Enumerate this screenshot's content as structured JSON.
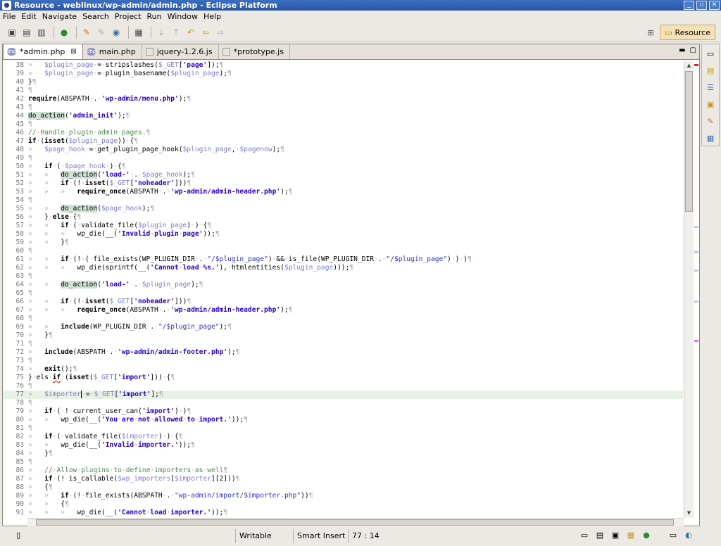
{
  "window": {
    "title": "Resource - weblinux/wp-admin/admin.php - Eclipse Platform",
    "controls": [
      "_",
      "▫",
      "✕"
    ]
  },
  "menu": [
    "File",
    "Edit",
    "Navigate",
    "Search",
    "Project",
    "Run",
    "Window",
    "Help"
  ],
  "perspective": {
    "label": "Resource"
  },
  "tabs": [
    {
      "label": "*admin.php",
      "icon": "php-file-icon",
      "active": true,
      "close": "⊠"
    },
    {
      "label": "main.php",
      "icon": "php-file-icon",
      "active": false
    },
    {
      "label": "jquery-1.2.6.js",
      "icon": "js-file-icon",
      "active": false
    },
    {
      "label": "*prototype.js",
      "icon": "js-file-icon",
      "active": false
    }
  ],
  "status": {
    "mode": "Writable",
    "insert": "Smart Insert",
    "position": "77 : 14"
  },
  "code": {
    "current_line": 77,
    "lines": [
      {
        "n": "38",
        "h": "<span class='ws'>»   </span><span class='var'>$plugin_page</span><span class='ws'>·</span>=<span class='ws'>·</span>stripslashes(<span class='var'>$_GET</span>[<span class='str'>'page'</span>]);<span class='ws'>¶</span>"
      },
      {
        "n": "39",
        "h": "<span class='ws'>»   </span><span class='var'>$plugin_page</span><span class='ws'>·</span>=<span class='ws'>·</span>plugin_basename(<span class='var'>$plugin_page</span>);<span class='ws'>¶</span>"
      },
      {
        "n": "40",
        "h": "}<span class='ws'>¶</span>"
      },
      {
        "n": "41",
        "h": "<span class='ws'>¶</span>"
      },
      {
        "n": "42",
        "h": "<span class='kw'>require</span>(ABSPATH<span class='ws'>·</span>.<span class='ws'>·</span><span class='str'>'wp-admin/menu.php'</span>);<span class='ws'>¶</span>"
      },
      {
        "n": "43",
        "h": "<span class='ws'>¶</span>"
      },
      {
        "n": "44",
        "h": "<span class='hl'>do_action</span>(<span class='str'>'admin_init'</span>);<span class='ws'>¶</span>"
      },
      {
        "n": "45",
        "h": "<span class='ws'>¶</span>"
      },
      {
        "n": "46",
        "h": "<span class='cmt'>//<span class='ws'>·</span>Handle<span class='ws'>·</span>plugin<span class='ws'>·</span>admin<span class='ws'>·</span>pages.</span><span class='ws'>¶</span>"
      },
      {
        "n": "47",
        "h": "<span class='kw'>if</span><span class='ws'>·</span>(<span class='kw'>isset</span>(<span class='var'>$plugin_page</span>))<span class='ws'>·</span>{<span class='ws'>¶</span>"
      },
      {
        "n": "48",
        "h": "<span class='ws'>»   </span><span class='var'>$page_hook</span><span class='ws'>·</span>=<span class='ws'>·</span>get_plugin_page_hook(<span class='var'>$plugin_page</span>,<span class='ws'>·</span><span class='var'>$pagenow</span>);<span class='ws'>¶</span>"
      },
      {
        "n": "49",
        "h": "<span class='ws'>¶</span>"
      },
      {
        "n": "50",
        "h": "<span class='ws'>»   </span><span class='kw'>if</span><span class='ws'>·</span>(<span class='ws'>·</span><span class='var'>$page_hook</span><span class='ws'>·</span>)<span class='ws'>·</span>{<span class='ws'>¶</span>"
      },
      {
        "n": "51",
        "h": "<span class='ws'>»   »   </span><span class='hl'>do_action</span>(<span class='str'>'load-'</span><span class='ws'>·</span>.<span class='ws'>·</span><span class='var'>$page_hook</span>);<span class='ws'>¶</span>"
      },
      {
        "n": "52",
        "h": "<span class='ws'>»   »   </span><span class='kw'>if</span><span class='ws'>·</span>(!<span class='ws'>·</span><span class='kw'>isset</span>(<span class='var'>$_GET</span>[<span class='str'>'noheader'</span>]))<span class='ws'>¶</span>"
      },
      {
        "n": "53",
        "h": "<span class='ws'>»   »   »   </span><span class='kw'>require_once</span>(ABSPATH<span class='ws'>·</span>.<span class='ws'>·</span><span class='str'>'wp-admin/admin-header.php'</span>);<span class='ws'>¶</span>"
      },
      {
        "n": "54",
        "h": "<span class='ws'>¶</span>"
      },
      {
        "n": "55",
        "h": "<span class='ws'>»   »   </span><span class='hl'>do_action</span>(<span class='var'>$page_hook</span>);<span class='ws'>¶</span>"
      },
      {
        "n": "56",
        "h": "<span class='ws'>»   </span>}<span class='ws'>·</span><span class='kw'>else</span><span class='ws'>·</span>{<span class='ws'>¶</span>"
      },
      {
        "n": "57",
        "h": "<span class='ws'>»   »   </span><span class='kw'>if</span><span class='ws'>·</span>(<span class='ws'>·</span>validate_file(<span class='var'>$plugin_page</span>)<span class='ws'>·</span>)<span class='ws'>·</span>{<span class='ws'>¶</span>"
      },
      {
        "n": "58",
        "h": "<span class='ws'>»   »   »   </span>wp_die(__(<span class='str'>'Invalid<span class='ws'>·</span>plugin<span class='ws'>·</span>page'</span>));<span class='ws'>¶</span>"
      },
      {
        "n": "59",
        "h": "<span class='ws'>»   »   </span>}<span class='ws'>¶</span>"
      },
      {
        "n": "60",
        "h": "<span class='ws'>¶</span>"
      },
      {
        "n": "61",
        "h": "<span class='ws'>»   »   </span><span class='kw'>if</span><span class='ws'>·</span>(!<span class='ws'>·</span>(<span class='ws'>·</span>file_exists(WP_PLUGIN_DIR<span class='ws'>·</span>.<span class='ws'>·</span><span class='str2'>\"/$plugin_page\"</span>)<span class='ws'>·</span>&amp;&amp;<span class='ws'>·</span>is_file(WP_PLUGIN_DIR<span class='ws'>·</span>.<span class='ws'>·</span><span class='str2'>\"/$plugin_page\"</span>)<span class='ws'>·</span>)<span class='ws'>·</span>)<span class='ws'>¶</span>"
      },
      {
        "n": "62",
        "h": "<span class='ws'>»   »   »   </span>wp_die(sprintf(__(<span class='str'>'Cannot<span class='ws'>·</span>load<span class='ws'>·</span>%s.'</span>),<span class='ws'>·</span>htmlentities(<span class='var'>$plugin_page</span>)));<span class='ws'>¶</span>"
      },
      {
        "n": "63",
        "h": "<span class='ws'>¶</span>"
      },
      {
        "n": "64",
        "h": "<span class='ws'>»   »   </span><span class='hl'>do_action</span>(<span class='str'>'load-'</span><span class='ws'>·</span>.<span class='ws'>·</span><span class='var'>$plugin_page</span>);<span class='ws'>¶</span>"
      },
      {
        "n": "65",
        "h": "<span class='ws'>¶</span>"
      },
      {
        "n": "66",
        "h": "<span class='ws'>»   »   </span><span class='kw'>if</span><span class='ws'>·</span>(!<span class='ws'>·</span><span class='kw'>isset</span>(<span class='var'>$_GET</span>[<span class='str'>'noheader'</span>]))<span class='ws'>¶</span>"
      },
      {
        "n": "67",
        "h": "<span class='ws'>»   »   »   </span><span class='kw'>require_once</span>(ABSPATH<span class='ws'>·</span>.<span class='ws'>·</span><span class='str'>'wp-admin/admin-header.php'</span>);<span class='ws'>¶</span>"
      },
      {
        "n": "68",
        "h": "<span class='ws'>¶</span>"
      },
      {
        "n": "69",
        "h": "<span class='ws'>»   »   </span><span class='kw'>include</span>(WP_PLUGIN_DIR<span class='ws'>·</span>.<span class='ws'>·</span><span class='str2'>\"/$plugin_page\"</span>);<span class='ws'>¶</span>"
      },
      {
        "n": "70",
        "h": "<span class='ws'>»   </span>}<span class='ws'>¶</span>"
      },
      {
        "n": "71",
        "h": "<span class='ws'>¶</span>"
      },
      {
        "n": "72",
        "h": "<span class='ws'>»   </span><span class='kw'>include</span>(ABSPATH<span class='ws'>·</span>.<span class='ws'>·</span><span class='str'>'wp-admin/admin-footer.php'</span>);<span class='ws'>¶</span>"
      },
      {
        "n": "73",
        "h": "<span class='ws'>¶</span>"
      },
      {
        "n": "74",
        "h": "<span class='ws'>»   </span><span class='kw'>exit</span>();<span class='ws'>¶</span>"
      },
      {
        "n": "75",
        "h": "}<span class='ws'>·</span>els<span class='ws'>·</span><span class='kw sq'>if</span><span class='ws'>·</span>(<span class='kw'>isset</span>(<span class='var'>$_GET</span>[<span class='str'>'import'</span>]))<span class='ws'>·</span>{<span class='ws'>¶</span>"
      },
      {
        "n": "76",
        "h": "<span class='ws'>¶</span>"
      },
      {
        "n": "77",
        "h": "<span class='ws'>»   </span><span class='var'>$importer</span><span class='caret'></span><span class='ws'>·</span>=<span class='ws'>·</span><span class='var'>$_GET</span>[<span class='str'>'import'</span>];<span class='ws'>¶</span>"
      },
      {
        "n": "78",
        "h": "<span class='ws'>¶</span>"
      },
      {
        "n": "79",
        "h": "<span class='ws'>»   </span><span class='kw'>if</span><span class='ws'>·</span>(<span class='ws'>·</span>!<span class='ws'>·</span>current_user_can(<span class='str'>'import'</span>)<span class='ws'>·</span>)<span class='ws'>¶</span>"
      },
      {
        "n": "80",
        "h": "<span class='ws'>»   »   </span>wp_die(__(<span class='str'>'You<span class='ws'>·</span>are<span class='ws'>·</span>not<span class='ws'>·</span>allowed<span class='ws'>·</span>to<span class='ws'>·</span>import.'</span>));<span class='ws'>¶</span>"
      },
      {
        "n": "81",
        "h": "<span class='ws'>¶</span>"
      },
      {
        "n": "82",
        "h": "<span class='ws'>»   </span><span class='kw'>if</span><span class='ws'>·</span>(<span class='ws'>·</span>validate_file(<span class='var'>$importer</span>)<span class='ws'>·</span>)<span class='ws'>·</span>{<span class='ws'>¶</span>"
      },
      {
        "n": "83",
        "h": "<span class='ws'>»   »   </span>wp_die(__(<span class='str'>'Invalid<span class='ws'>·</span>importer.'</span>));<span class='ws'>¶</span>"
      },
      {
        "n": "84",
        "h": "<span class='ws'>»   </span>}<span class='ws'>¶</span>"
      },
      {
        "n": "85",
        "h": "<span class='ws'>¶</span>"
      },
      {
        "n": "86",
        "h": "<span class='ws'>»   </span><span class='cmt'>//<span class='ws'>·</span>Allow<span class='ws'>·</span>plugins<span class='ws'>·</span>to<span class='ws'>·</span>define<span class='ws'>·</span>importers<span class='ws'>·</span>as<span class='ws'>·</span>well</span><span class='ws'>¶</span>"
      },
      {
        "n": "87",
        "h": "<span class='ws'>»   </span><span class='kw'>if</span><span class='ws'>·</span>(!<span class='ws'>·</span>is_callable(<span class='var'>$wp_importers</span>[<span class='var'>$importer</span>][2]))<span class='ws'>¶</span>"
      },
      {
        "n": "88",
        "h": "<span class='ws'>»   </span>{<span class='ws'>¶</span>"
      },
      {
        "n": "89",
        "h": "<span class='ws'>»   »   </span><span class='kw'>if</span><span class='ws'>·</span>(!<span class='ws'>·</span>file_exists(ABSPATH<span class='ws'>·</span>.<span class='ws'>·</span><span class='str2'>\"wp-admin/import/$importer.php\"</span>))<span class='ws'>¶</span>"
      },
      {
        "n": "90",
        "h": "<span class='ws'>»   »   </span>{<span class='ws'>¶</span>"
      },
      {
        "n": "91",
        "h": "<span class='ws'>»   »   »   </span>wp_die(__(<span class='str'>'Cannot<span class='ws'>·</span>load<span class='ws'>·</span>importer.'</span>));<span class='ws'>¶</span>"
      }
    ]
  }
}
